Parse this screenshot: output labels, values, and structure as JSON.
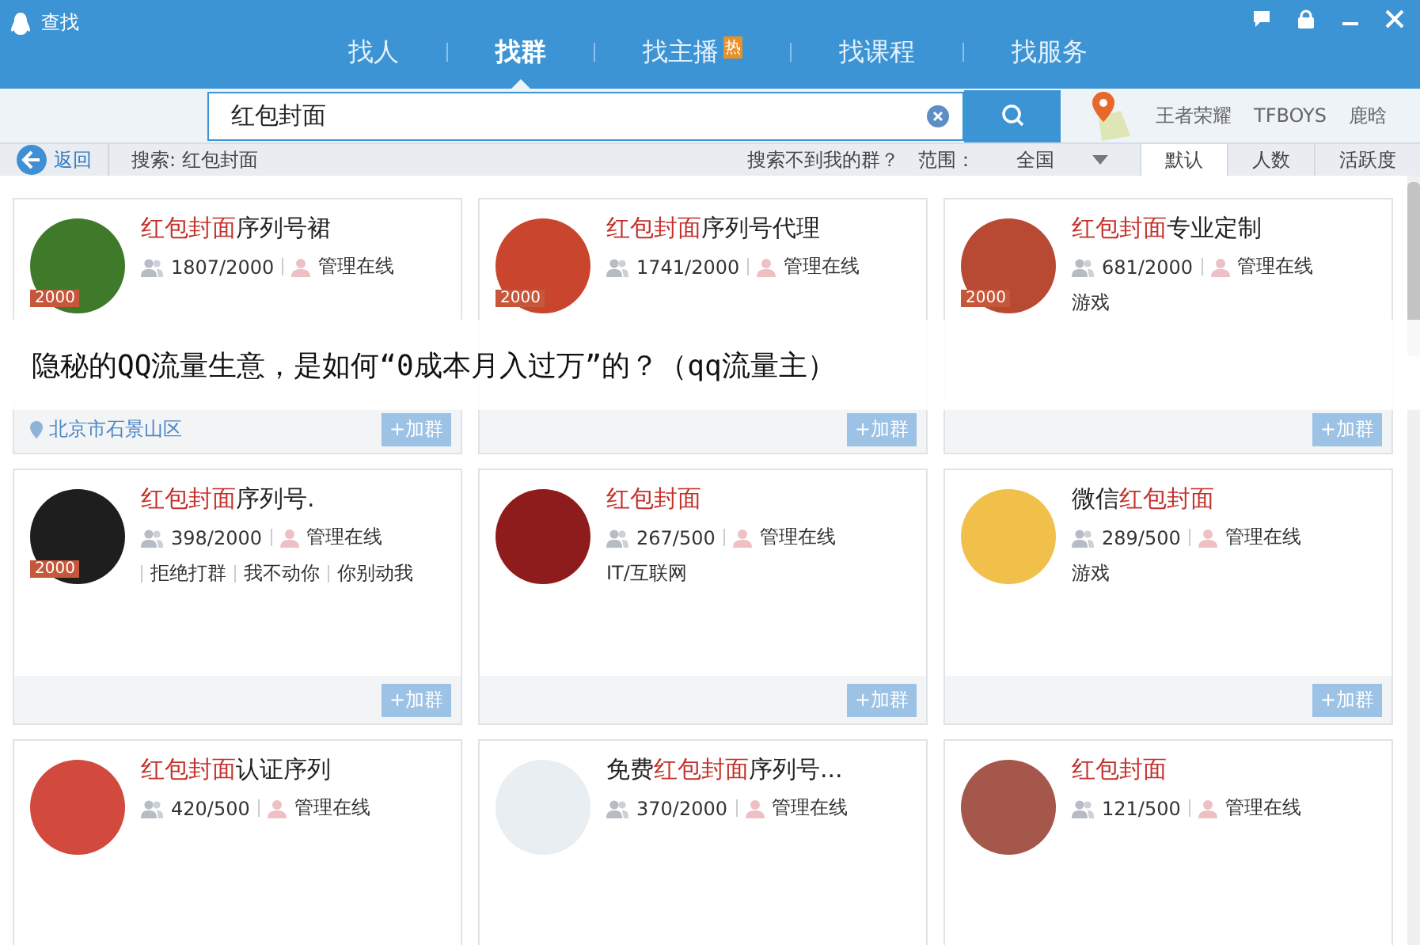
{
  "window": {
    "title": "查找"
  },
  "tabs": [
    {
      "label": "找人",
      "selected": false
    },
    {
      "label": "找群",
      "selected": true
    },
    {
      "label": "找主播",
      "selected": false,
      "badge": "热"
    },
    {
      "label": "找课程",
      "selected": false
    },
    {
      "label": "找服务",
      "selected": false
    }
  ],
  "search": {
    "value": "红包封面"
  },
  "hot_keywords": [
    "王者荣耀",
    "TFBOYS",
    "鹿晗"
  ],
  "filter_bar": {
    "back": "返回",
    "query": "搜索: 红包封面",
    "help_link": "搜索不到我的群？",
    "range_label": "范围：",
    "range_value": "全国",
    "sorts": [
      {
        "label": "默认",
        "selected": true
      },
      {
        "label": "人数",
        "selected": false
      },
      {
        "label": "活跃度",
        "selected": false
      }
    ]
  },
  "groups": [
    {
      "title": [
        {
          "text": "红包封面",
          "highlight": true
        },
        {
          "text": "序列号裙",
          "highlight": false
        }
      ],
      "badge": "2000",
      "members": "1807/2000",
      "admin": "管理在线",
      "location": "北京市石景山区",
      "join": "+加群"
    },
    {
      "title": [
        {
          "text": "红包封面",
          "highlight": true
        },
        {
          "text": "序列号代理",
          "highlight": false
        }
      ],
      "badge": "2000",
      "members": "1741/2000",
      "admin": "管理在线",
      "join": "+加群"
    },
    {
      "title": [
        {
          "text": "红包封面",
          "highlight": true
        },
        {
          "text": "专业定制",
          "highlight": false
        }
      ],
      "badge": "2000",
      "members": "681/2000",
      "admin": "管理在线",
      "category": "游戏",
      "join": "+加群"
    },
    {
      "title": [
        {
          "text": "红包封面",
          "highlight": true
        },
        {
          "text": "序列号.",
          "highlight": false
        }
      ],
      "badge": "2000",
      "members": "398/2000",
      "admin": "管理在线",
      "tags": [
        "拒绝打群",
        "我不动你",
        "你别动我"
      ],
      "join": "+加群"
    },
    {
      "title": [
        {
          "text": "红包封面",
          "highlight": true
        }
      ],
      "members": "267/500",
      "admin": "管理在线",
      "category": "IT/互联网",
      "join": "+加群"
    },
    {
      "title": [
        {
          "text": "微信",
          "highlight": false
        },
        {
          "text": "红包封面",
          "highlight": true
        }
      ],
      "members": "289/500",
      "admin": "管理在线",
      "category": "游戏",
      "join": "+加群"
    },
    {
      "title": [
        {
          "text": "红包封面",
          "highlight": true
        },
        {
          "text": "认证序列",
          "highlight": false
        }
      ],
      "members": "420/500",
      "admin": "管理在线"
    },
    {
      "title": [
        {
          "text": "免费",
          "highlight": false
        },
        {
          "text": "红包封面",
          "highlight": true
        },
        {
          "text": "序列号...",
          "highlight": false
        }
      ],
      "members": "370/2000",
      "admin": "管理在线"
    },
    {
      "title": [
        {
          "text": "红包封面",
          "highlight": true
        }
      ],
      "members": "121/500",
      "admin": "管理在线"
    }
  ],
  "overlay_caption": "隐秘的QQ流量生意，是如何“0成本月入过万”的？（qq流量主）"
}
